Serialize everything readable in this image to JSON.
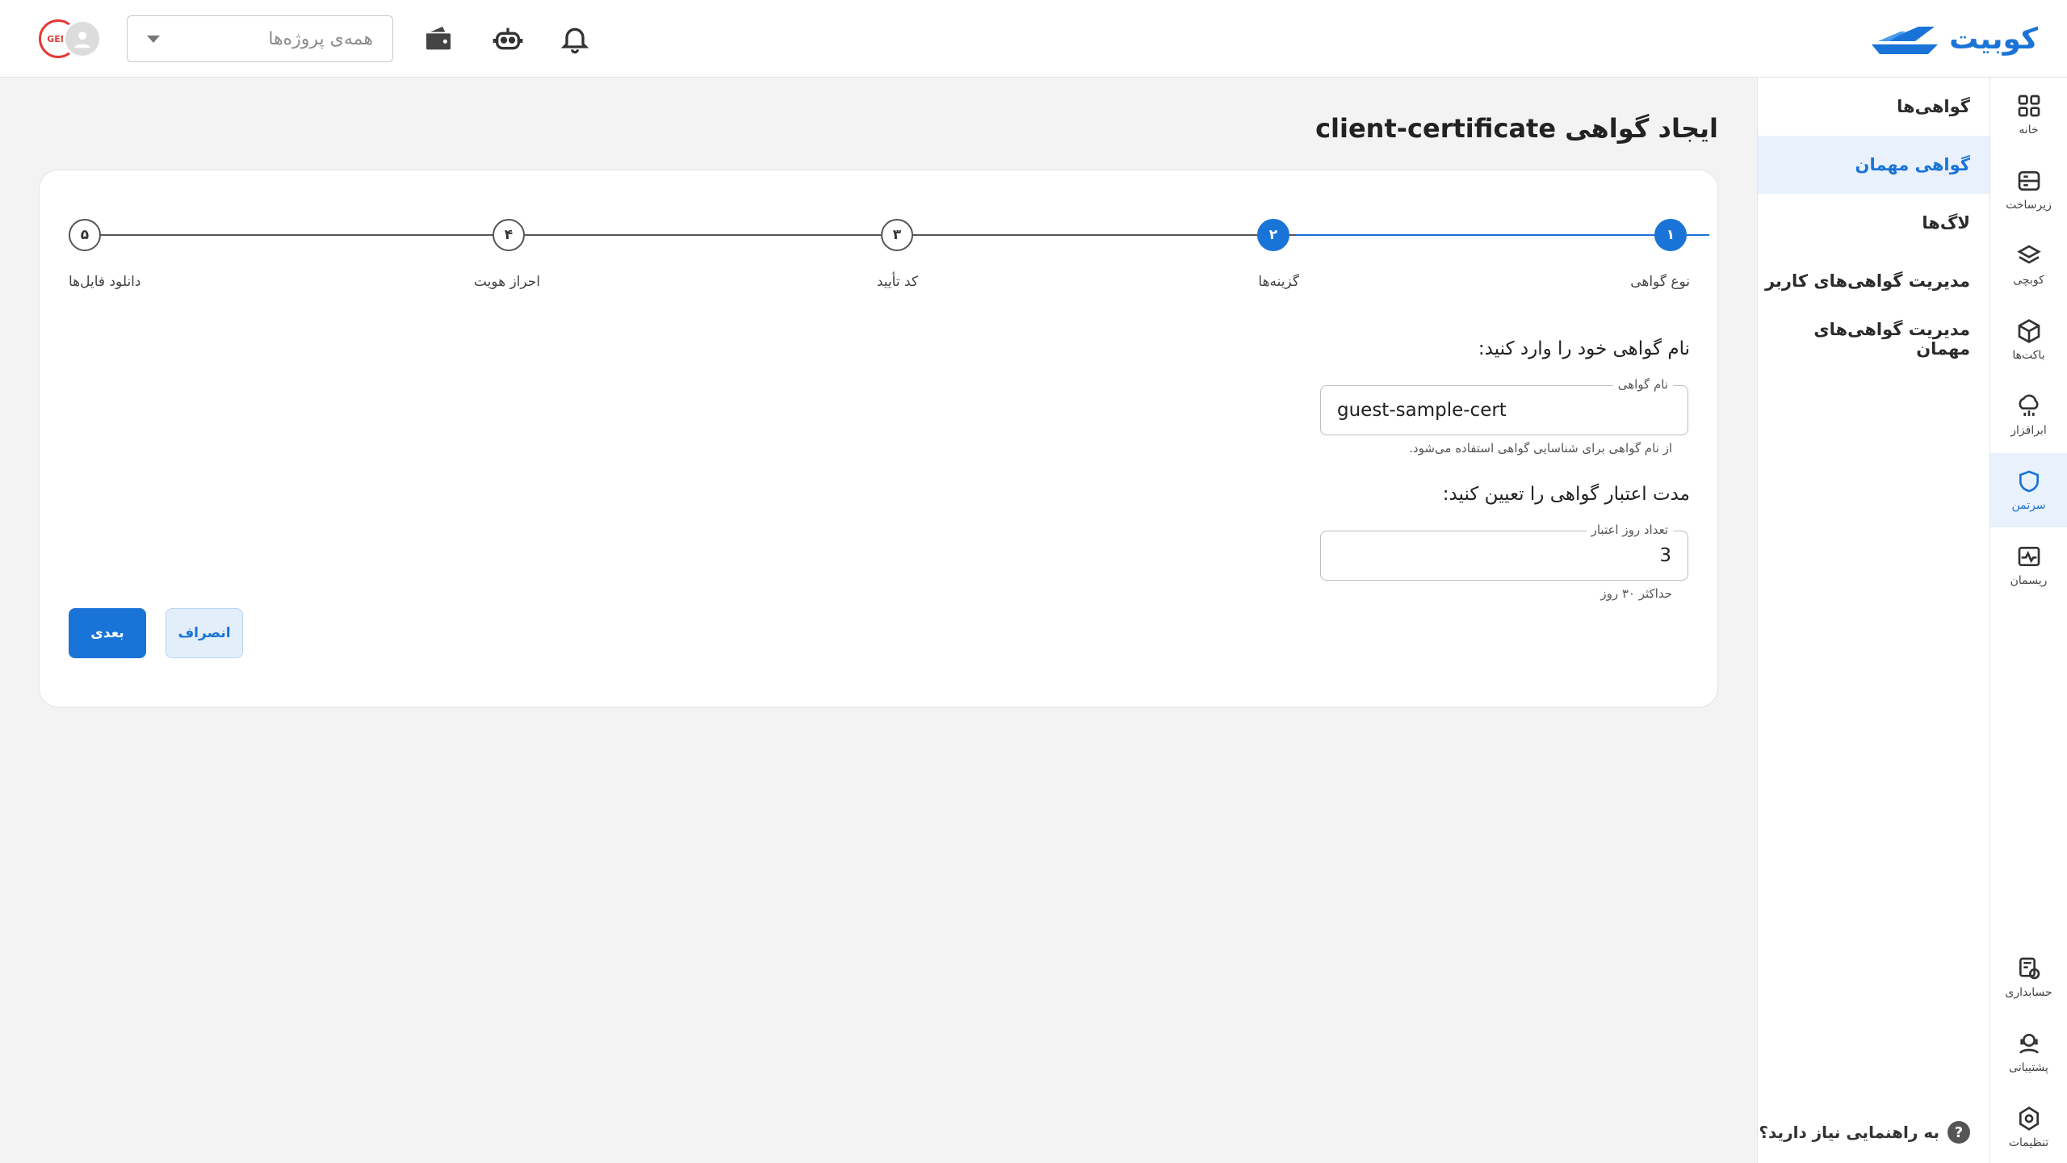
{
  "header": {
    "brand": "کوبیت",
    "project_select": {
      "placeholder": "همه‌ی پروژه‌ها"
    },
    "icons": [
      "notification-bell-icon",
      "robot-icon",
      "wallet-icon"
    ],
    "avatar_badge": "GEM"
  },
  "rail": {
    "items": [
      {
        "label": "خانه",
        "icon": "grid-icon"
      },
      {
        "label": "زیرساخت",
        "icon": "server-icon"
      },
      {
        "label": "کوبچی",
        "icon": "layers-icon"
      },
      {
        "label": "باکت‌ها",
        "icon": "cube-icon"
      },
      {
        "label": "ابرافزار",
        "icon": "cloud-app-icon"
      },
      {
        "label": "سرتمن",
        "icon": "shield-icon"
      },
      {
        "label": "ریسمان",
        "icon": "pulse-icon"
      }
    ],
    "bottom_items": [
      {
        "label": "حسابداری",
        "icon": "accounting-icon"
      },
      {
        "label": "پشتیبانی",
        "icon": "support-icon"
      },
      {
        "label": "تنظیمات",
        "icon": "settings-icon"
      }
    ],
    "active_index": 5
  },
  "subnav": {
    "items": [
      {
        "label": "گواهی‌ها"
      },
      {
        "label": "گواهی مهمان"
      },
      {
        "label": "لاگ‌ها"
      },
      {
        "label": "مدیریت گواهی‌های کاربر"
      },
      {
        "label": "مدیریت گواهی‌های مهمان"
      }
    ],
    "active_index": 1,
    "help": "به راهنمایی نیاز دارید؟"
  },
  "page": {
    "title": "ایجاد گواهی client-certificate"
  },
  "stepper": {
    "steps": [
      {
        "num": "۱",
        "label": "نوع گواهی",
        "state": "done"
      },
      {
        "num": "۲",
        "label": "گزینه‌ها",
        "state": "current"
      },
      {
        "num": "۳",
        "label": "کد تأیید",
        "state": "todo"
      },
      {
        "num": "۴",
        "label": "احراز هویت",
        "state": "todo"
      },
      {
        "num": "۵",
        "label": "دانلود فایل‌ها",
        "state": "todo"
      }
    ]
  },
  "form": {
    "name_section_label": "نام گواهی خود را وارد کنید:",
    "name_field": {
      "legend": "نام گواهی",
      "value": "guest-sample-cert",
      "helper": "از نام گواهی برای شناسایی گواهی استفاده می‌شود."
    },
    "validity_section_label": "مدت اعتبار گواهی را تعیین کنید:",
    "days_field": {
      "legend": "تعداد روز اعتبار",
      "value": "3",
      "helper": "حداکثر ۳۰ روز"
    }
  },
  "actions": {
    "next_label": "بعدی",
    "cancel_label": "انصراف"
  },
  "colors": {
    "accent": "#1a74d8",
    "accent_light": "#e9f1fc",
    "background": "#f3f3f3"
  }
}
